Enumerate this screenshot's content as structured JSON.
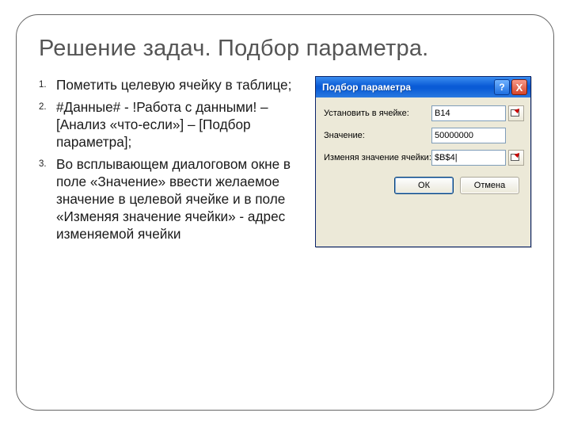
{
  "slide": {
    "title": "Решение задач. Подбор параметра.",
    "steps": [
      "Пометить целевую ячейку в таблице;",
      "#Данные# - !Работа с данными! – [Анализ «что-если»] – [Подбор параметра];",
      "Во всплывающем диалоговом окне в поле «Значение» ввести желаемое значение в целевой ячейке и в поле «Изменяя значение ячейки» - адрес изменяемой ячейки"
    ]
  },
  "dialog": {
    "title": "Подбор параметра",
    "help_char": "?",
    "close_char": "X",
    "set_cell_label": "Установить в ячейке:",
    "set_cell_value": "B14",
    "value_label": "Значение:",
    "value_value": "50000000",
    "changing_label": "Изменяя значение ячейки:",
    "changing_value": "$B$4|",
    "ok_label": "ОК",
    "cancel_label": "Отмена"
  }
}
